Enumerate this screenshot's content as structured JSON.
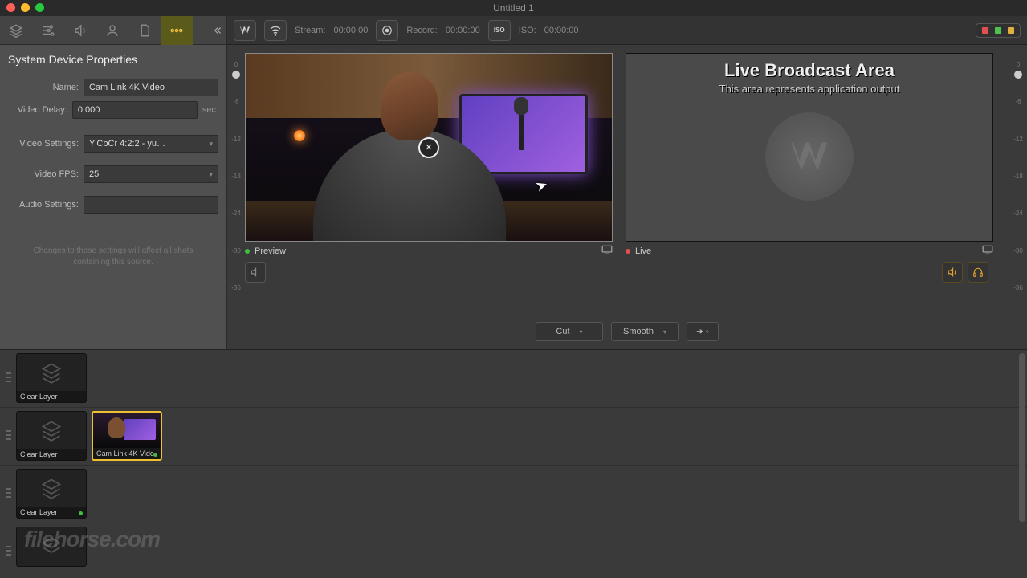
{
  "window": {
    "title": "Untitled 1"
  },
  "panel": {
    "title": "System Device Properties",
    "name_label": "Name:",
    "name_value": "Cam Link 4K Video",
    "delay_label": "Video Delay:",
    "delay_value": "0.000",
    "delay_unit": "sec",
    "vsettings_label": "Video Settings:",
    "vsettings_value": "Y'CbCr 4:2:2 - yu…",
    "fps_label": "Video FPS:",
    "fps_value": "25",
    "asettings_label": "Audio Settings:",
    "asettings_value": "",
    "hint": "Changes to these settings will affect all shots containing this source."
  },
  "toolbar": {
    "stream_label": "Stream:",
    "stream_time": "00:00:00",
    "record_label": "Record:",
    "record_time": "00:00:00",
    "iso_btn": "ISO",
    "iso_label": "ISO:",
    "iso_time": "00:00:00"
  },
  "meter_ticks": [
    "0",
    "-6",
    "-12",
    "-18",
    "-24",
    "-30",
    "-36"
  ],
  "preview": {
    "label": "Preview"
  },
  "live": {
    "label": "Live",
    "broadcast_title": "Live Broadcast Area",
    "broadcast_sub": "This area represents application output"
  },
  "transition": {
    "cut": "Cut",
    "smooth": "Smooth"
  },
  "shots": {
    "clear": "Clear Layer",
    "cam": "Cam Link 4K Vide"
  },
  "watermark": "filehorse.com"
}
